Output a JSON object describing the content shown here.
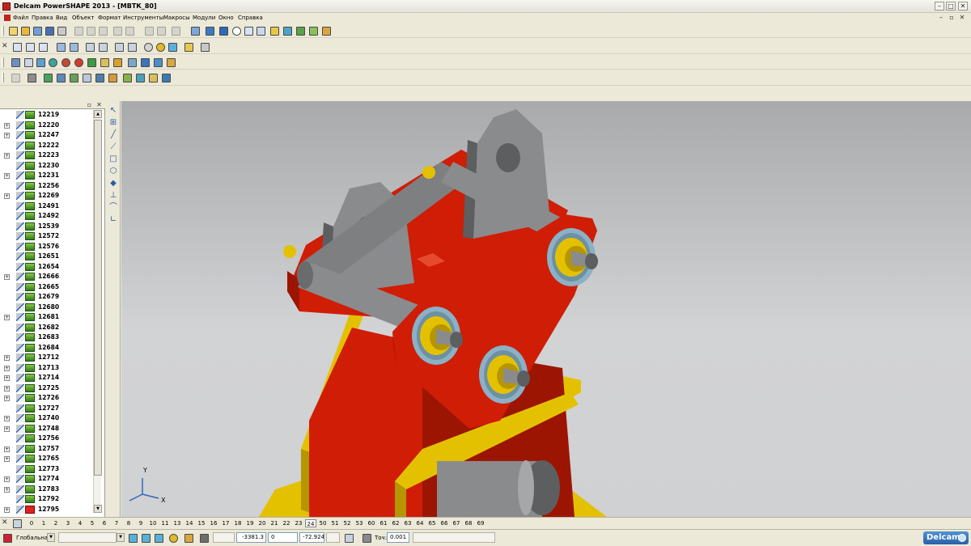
{
  "window": {
    "title": "Delcam PowerSHAPE 2013 - [МВТК_80]",
    "min": "–",
    "max": "□",
    "close": "✕"
  },
  "menu": {
    "items": [
      "Файл",
      "Правка",
      "Вид",
      "Объект",
      "Формат",
      "Инструменты",
      "Макросы",
      "Модули",
      "Окно",
      "Справка"
    ],
    "mdi": {
      "min": "–",
      "restore": "▫",
      "close": "✕"
    }
  },
  "toolbars": {
    "close_glyph": "✕"
  },
  "tree": {
    "items": [
      {
        "label": "12219",
        "expand": false,
        "icon": "part-icon"
      },
      {
        "label": "12220",
        "expand": true,
        "icon": "part-icon"
      },
      {
        "label": "12247",
        "expand": true,
        "icon": "part-icon"
      },
      {
        "label": "12222",
        "expand": false,
        "icon": "part-icon"
      },
      {
        "label": "12223",
        "expand": true,
        "icon": "part-icon"
      },
      {
        "label": "12230",
        "expand": false,
        "icon": "part-icon"
      },
      {
        "label": "12231",
        "expand": true,
        "icon": "part-icon"
      },
      {
        "label": "12256",
        "expand": false,
        "icon": "part-icon"
      },
      {
        "label": "12269",
        "expand": true,
        "icon": "part-icon"
      },
      {
        "label": "12491",
        "expand": false,
        "icon": "part-icon"
      },
      {
        "label": "12492",
        "expand": false,
        "icon": "part-icon"
      },
      {
        "label": "12539",
        "expand": false,
        "icon": "part-icon"
      },
      {
        "label": "12572",
        "expand": false,
        "icon": "part-icon"
      },
      {
        "label": "12576",
        "expand": false,
        "icon": "part-icon"
      },
      {
        "label": "12651",
        "expand": false,
        "icon": "part-icon"
      },
      {
        "label": "12654",
        "expand": false,
        "icon": "part-icon"
      },
      {
        "label": "12666",
        "expand": true,
        "icon": "part-icon"
      },
      {
        "label": "12665",
        "expand": false,
        "icon": "part-icon"
      },
      {
        "label": "12679",
        "expand": false,
        "icon": "part-icon"
      },
      {
        "label": "12680",
        "expand": false,
        "icon": "part-icon"
      },
      {
        "label": "12681",
        "expand": true,
        "icon": "part-icon"
      },
      {
        "label": "12682",
        "expand": false,
        "icon": "part-icon"
      },
      {
        "label": "12683",
        "expand": false,
        "icon": "part-icon"
      },
      {
        "label": "12684",
        "expand": false,
        "icon": "part-icon"
      },
      {
        "label": "12712",
        "expand": true,
        "icon": "part-icon"
      },
      {
        "label": "12713",
        "expand": true,
        "icon": "part-icon"
      },
      {
        "label": "12714",
        "expand": true,
        "icon": "part-icon"
      },
      {
        "label": "12725",
        "expand": true,
        "icon": "part-icon"
      },
      {
        "label": "12726",
        "expand": true,
        "icon": "part-icon"
      },
      {
        "label": "12727",
        "expand": false,
        "icon": "part-icon"
      },
      {
        "label": "12740",
        "expand": true,
        "icon": "part-icon"
      },
      {
        "label": "12748",
        "expand": true,
        "icon": "part-icon"
      },
      {
        "label": "12756",
        "expand": false,
        "icon": "part-icon"
      },
      {
        "label": "12757",
        "expand": true,
        "icon": "part-icon"
      },
      {
        "label": "12765",
        "expand": true,
        "icon": "part-icon"
      },
      {
        "label": "12773",
        "expand": false,
        "icon": "part-icon"
      },
      {
        "label": "12774",
        "expand": true,
        "icon": "part-icon"
      },
      {
        "label": "12783",
        "expand": true,
        "icon": "part-icon"
      },
      {
        "label": "12792",
        "expand": false,
        "icon": "part-icon"
      },
      {
        "label": "12795",
        "expand": true,
        "icon": "flag-icon"
      }
    ],
    "expand_glyph": "+",
    "scroll_up": "▲",
    "scroll_down": "▼",
    "pin": "▫",
    "close": "✕"
  },
  "side_tools": [
    "select-arrow-icon",
    "line-icon",
    "line-icon",
    "arc-icon",
    "rectangle-icon",
    "polygon-icon",
    "solid-icon",
    "dimension-icon",
    "curve-icon",
    "angle-icon"
  ],
  "side_glyphs": [
    "↖",
    "⊞",
    "╱",
    "⟋",
    "□",
    "⬡",
    "◆",
    "⊥",
    "⌒",
    "∟"
  ],
  "viewport": {
    "background_top": "#a9aaac",
    "background_bottom": "#d0d1d3",
    "axis_y": "Y",
    "axis_x": "X",
    "colors": {
      "red": "#d01d06",
      "red_dark": "#9c1502",
      "yellow": "#e4c100",
      "yellow_dark": "#b59600",
      "steel": "#8a8b8d",
      "steel_dark": "#5d5e60",
      "washer": "#8ab1c6"
    }
  },
  "levels": {
    "close": "✕",
    "items": [
      "0",
      "1",
      "2",
      "3",
      "4",
      "5",
      "6",
      "7",
      "8",
      "9",
      "10",
      "11",
      "13",
      "14",
      "15",
      "16",
      "17",
      "18",
      "19",
      "20",
      "21",
      "22",
      "23",
      "24",
      "50",
      "51",
      "52",
      "53",
      "60",
      "61",
      "62",
      "63",
      "64",
      "65",
      "66",
      "67",
      "68",
      "69"
    ],
    "active": "24"
  },
  "status": {
    "workplane": "Глобальна",
    "coord_x": "-3381.3",
    "coord_y": "0",
    "coord_z": "-72.924",
    "tol_label": "Точ:",
    "tolerance": "0.001",
    "logo": "Delcam",
    "dd": "▼"
  }
}
